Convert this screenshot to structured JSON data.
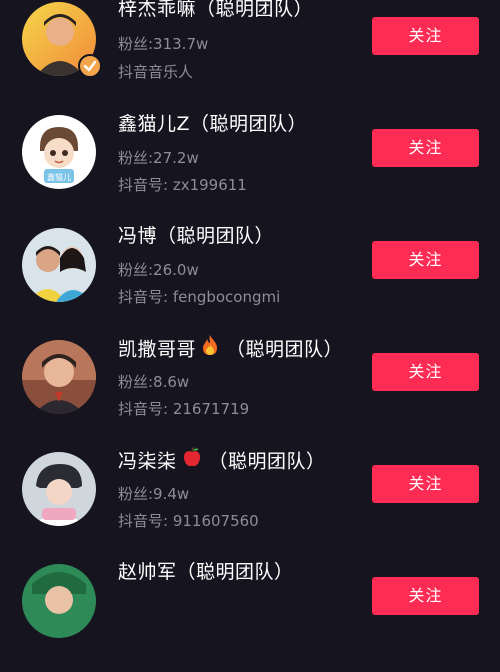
{
  "users": [
    {
      "name": "梓杰乖嘛（聪明团队）",
      "followers": "粉丝:313.7w",
      "meta": "抖音音乐人",
      "follow_label": "关注",
      "verified": true
    },
    {
      "name": "鑫猫儿Z（聪明团队）",
      "followers": "粉丝:27.2w",
      "meta": "抖音号: zx199611",
      "follow_label": "关注",
      "avatar_text": "鑫猫儿"
    },
    {
      "name": "冯博（聪明团队）",
      "followers": "粉丝:26.0w",
      "meta": "抖音号: fengbocongmi",
      "follow_label": "关注"
    },
    {
      "name_prefix": "凯撒哥哥",
      "name_suffix": "（聪明团队）",
      "name_emoji": "fire-icon",
      "followers": "粉丝:8.6w",
      "meta": "抖音号: 21671719",
      "follow_label": "关注"
    },
    {
      "name_prefix": "冯柒柒",
      "name_suffix": "（聪明团队）",
      "name_emoji": "apple-icon",
      "followers": "粉丝:9.4w",
      "meta": "抖音号: 911607560",
      "follow_label": "关注"
    },
    {
      "name": "赵帅军（聪明团队）",
      "follow_label": "关注"
    }
  ],
  "colors": {
    "background": "#15141f",
    "follow_button": "#fe2c55",
    "secondary_text": "#8e8d96",
    "verified_badge": "#f2a54a"
  }
}
